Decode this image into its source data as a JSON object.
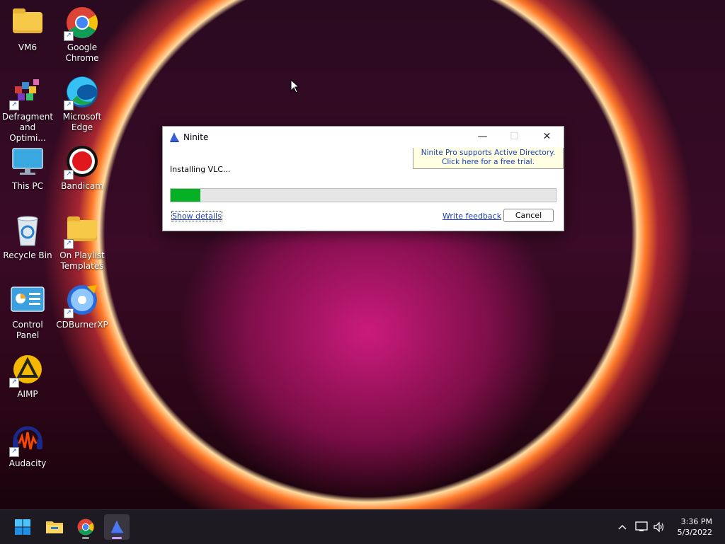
{
  "desktop": {
    "icons": [
      {
        "label": "VM6"
      },
      {
        "label": "Google\nChrome"
      },
      {
        "label": "Defragment\nand Optimi..."
      },
      {
        "label": "Microsoft\nEdge"
      },
      {
        "label": "This PC"
      },
      {
        "label": "Bandicam"
      },
      {
        "label": "Recycle Bin"
      },
      {
        "label": "On Playlist\nTemplates"
      },
      {
        "label": "Control Panel"
      },
      {
        "label": "CDBurnerXP"
      },
      {
        "label": "AIMP"
      },
      {
        "label": "Audacity"
      }
    ]
  },
  "dialog": {
    "title": "Ninite",
    "promo_line1": "Ninite Pro supports Active Directory.",
    "promo_line2": "Click here for a free trial.",
    "status": "Installing VLC...",
    "progress_percent": 7.7,
    "show_details": "Show details",
    "write_feedback": "Write feedback",
    "cancel": "Cancel",
    "minimize_glyph": "—",
    "maximize_glyph": "☐",
    "close_glyph": "✕"
  },
  "taskbar": {
    "items": [
      "start-icon",
      "file-explorer-icon",
      "chrome-icon",
      "ninite-icon"
    ],
    "tray": [
      "chevron-up-icon",
      "network-icon",
      "volume-icon"
    ],
    "time": "3:36 PM",
    "date": "5/3/2022"
  },
  "colors": {
    "progress_fill": "#06b025",
    "link": "#1a3fbf",
    "promo_bg": "#ffffe1"
  }
}
